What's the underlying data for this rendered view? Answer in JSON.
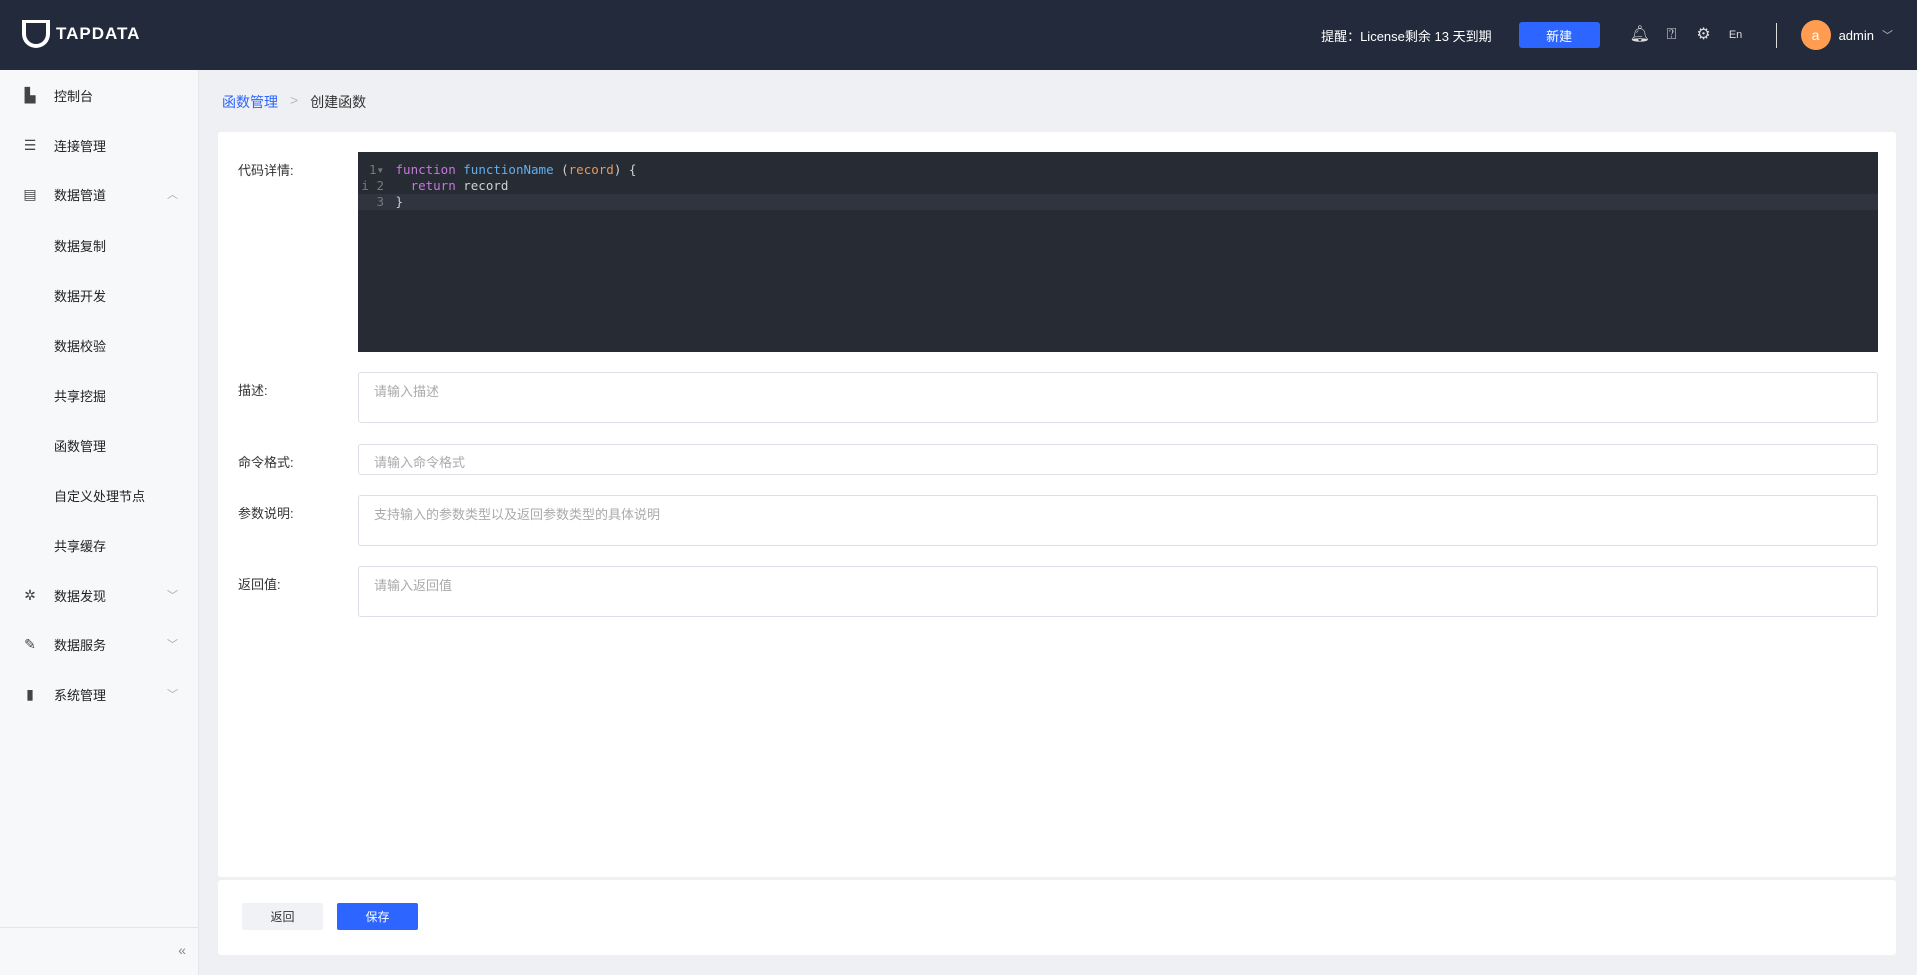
{
  "header": {
    "logo": "TAPDATA",
    "notice": "提醒：License剩余 13 天到期",
    "new_button": "新建",
    "user": "admin",
    "avatar_letter": "a",
    "icons": [
      "bell-icon",
      "help-icon",
      "gear-icon",
      "language-icon"
    ]
  },
  "sidebar": {
    "items": [
      {
        "label": "控制台",
        "icon": "dashboard-icon"
      },
      {
        "label": "连接管理",
        "icon": "list-icon"
      },
      {
        "label": "数据管道",
        "icon": "archive-icon",
        "expanded": true,
        "children": [
          "数据复制",
          "数据开发",
          "数据校验",
          "共享挖掘",
          "函数管理",
          "自定义处理节点",
          "共享缓存"
        ]
      },
      {
        "label": "数据发现",
        "icon": "chip-icon"
      },
      {
        "label": "数据服务",
        "icon": "plug-icon"
      },
      {
        "label": "系统管理",
        "icon": "book-icon"
      }
    ]
  },
  "breadcrumb": {
    "parent": "函数管理",
    "current": "创建函数"
  },
  "form": {
    "code_label": "代码详情:",
    "code": {
      "l1_kw": "function",
      "l1_fn": "functionName",
      "l1_open": " (",
      "l1_param": "record",
      "l1_close": ") {",
      "l2_kw": "return",
      "l2_rest": " record",
      "l3": "}"
    },
    "desc_label": "描述:",
    "desc_placeholder": "请输入描述",
    "cmd_label": "命令格式:",
    "cmd_placeholder": "请输入命令格式",
    "param_label": "参数说明:",
    "param_placeholder": "支持输入的参数类型以及返回参数类型的具体说明",
    "return_label": "返回值:",
    "return_placeholder": "请输入返回值"
  },
  "footer": {
    "back": "返回",
    "save": "保存"
  }
}
